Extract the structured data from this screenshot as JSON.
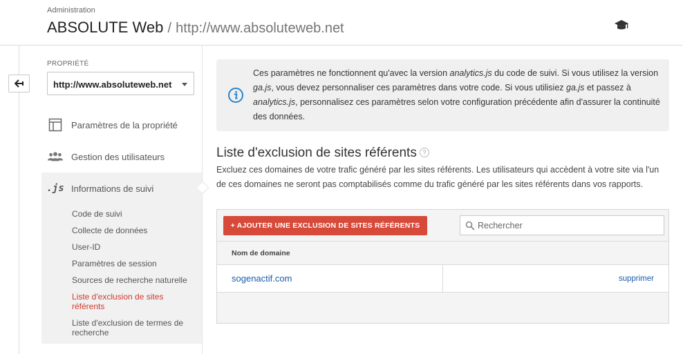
{
  "header": {
    "admin_label": "Administration",
    "account_name": "ABSOLUTE Web",
    "separator": "/",
    "property_url": "http://www.absoluteweb.net",
    "academy_icon": "graduation-cap-icon"
  },
  "rail": {
    "back_icon": "back-arrow-icon"
  },
  "sidebar": {
    "property_label": "PROPRIÉTÉ",
    "property_selected": "http://www.absoluteweb.net",
    "items": [
      {
        "label": "Paramètres de la propriété",
        "icon": "property-settings-icon"
      },
      {
        "label": "Gestion des utilisateurs",
        "icon": "users-icon"
      },
      {
        "label": "Informations de suivi",
        "icon": "js-icon",
        "icon_text": ".js"
      }
    ],
    "subitems": [
      {
        "label": "Code de suivi"
      },
      {
        "label": "Collecte de données"
      },
      {
        "label": "User-ID"
      },
      {
        "label": "Paramètres de session"
      },
      {
        "label": "Sources de recherche naturelle"
      },
      {
        "label": "Liste d'exclusion de sites référents",
        "active": true
      },
      {
        "label": "Liste d'exclusion de termes de recherche"
      }
    ]
  },
  "info": {
    "t1": "Ces paramètres ne fonctionnent qu'avec la version ",
    "t2": "analytics.js",
    "t3": " du code de suivi. Si vous utilisez la version ",
    "t4": "ga.js",
    "t5": ", vous devez personnaliser ces paramètres dans votre code. Si vous utilisiez ",
    "t6": "ga.js",
    "t7": " et passez à ",
    "t8": "analytics.js",
    "t9": ", personnalisez ces paramètres selon votre configuration précédente afin d'assurer la continuité des données."
  },
  "main": {
    "title": "Liste d'exclusion de sites référents",
    "help": "?",
    "description": "Excluez ces domaines de votre trafic généré par les sites référents. Les utilisateurs qui accèdent à votre site via l'un de ces domaines ne seront pas comptabilisés comme du trafic généré par les sites référents dans vos rapports.",
    "add_button": "+ AJOUTER UNE EXCLUSION DE SITES RÉFÉRENTS",
    "search_placeholder": "Rechercher",
    "column_domain": "Nom de domaine",
    "rows": [
      {
        "domain": "sogenactif.com",
        "action": "supprimer"
      }
    ]
  },
  "colors": {
    "accent_red": "#d74a3a",
    "active_nav": "#d0392b",
    "link_blue": "#1a5ca8",
    "info_blue": "#2a84c8"
  }
}
